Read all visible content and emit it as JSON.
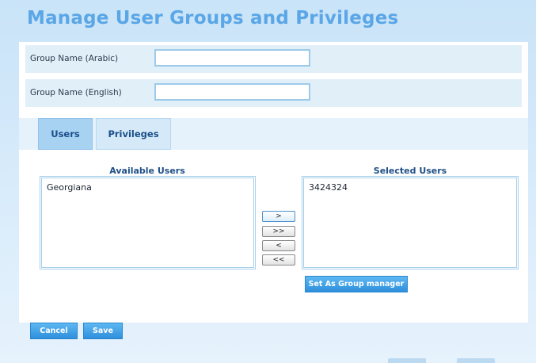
{
  "page": {
    "title": "Manage User Groups and Privileges"
  },
  "form": {
    "group_name_arabic": {
      "label": "Group Name (Arabic)",
      "value": "",
      "placeholder": ""
    },
    "group_name_english": {
      "label": "Group Name (English)",
      "value": "",
      "placeholder": ""
    }
  },
  "tabs": [
    {
      "label": "Users",
      "active": true
    },
    {
      "label": "Privileges",
      "active": false
    }
  ],
  "users": {
    "available_heading": "Available Users",
    "available_items": [
      "Georgiana"
    ],
    "selected_heading": "Selected Users",
    "selected_items": [
      "3424324"
    ],
    "move_buttons": {
      "move_one_right": ">",
      "move_all_right": ">>",
      "move_one_left": "<",
      "move_all_left": "<<"
    },
    "group_manager_button": "Set As Group manager"
  },
  "actions": {
    "cancel": "Cancel",
    "save": "Save"
  },
  "colors": {
    "title": "#5aa6e6",
    "primary_button": "#2e8fdc",
    "active_tab": "#a8d2f2",
    "row_background": "#e1eff9"
  }
}
